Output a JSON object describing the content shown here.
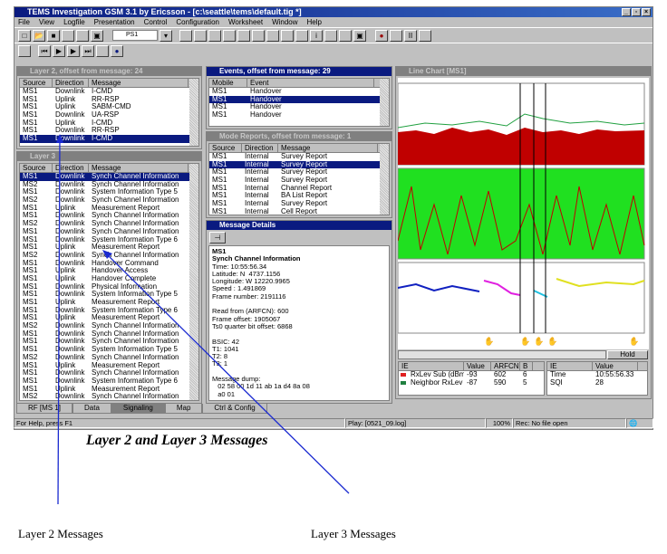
{
  "app": {
    "title": "TEMS Investigation GSM 3.1 by Ericsson - [c:\\seattle\\tems\\default.tig *]",
    "menu": [
      "File",
      "View",
      "Logfile",
      "Presentation",
      "Control",
      "Configuration",
      "Worksheet",
      "Window",
      "Help"
    ],
    "mobile_select": "PS1"
  },
  "layer2": {
    "title": "Layer 2, offset from message: 24",
    "columns": [
      "Source",
      "Direction",
      "Message"
    ],
    "rows": [
      [
        "MS1",
        "Downlink",
        "I-CMD"
      ],
      [
        "MS1",
        "Uplink",
        "RR-RSP"
      ],
      [
        "MS1",
        "Uplink",
        "SABM-CMD"
      ],
      [
        "MS1",
        "Downlink",
        "UA-RSP"
      ],
      [
        "MS1",
        "Uplink",
        "I-CMD"
      ],
      [
        "MS1",
        "Downlink",
        "RR-RSP"
      ],
      [
        "MS1",
        "Downlink",
        "I-CMD"
      ]
    ],
    "selected": 6
  },
  "layer3": {
    "title": "Layer 3",
    "columns": [
      "Source",
      "Direction",
      "Message"
    ],
    "rows": [
      [
        "MS1",
        "Downlink",
        "Synch Channel Information"
      ],
      [
        "MS2",
        "Downlink",
        "Synch Channel Information"
      ],
      [
        "MS1",
        "Downlink",
        "System Information Type 5"
      ],
      [
        "MS2",
        "Downlink",
        "Synch Channel Information"
      ],
      [
        "MS1",
        "Uplink",
        "Measurement Report"
      ],
      [
        "MS1",
        "Downlink",
        "Synch Channel Information"
      ],
      [
        "MS2",
        "Downlink",
        "Synch Channel Information"
      ],
      [
        "MS1",
        "Downlink",
        "Synch Channel Information"
      ],
      [
        "MS1",
        "Downlink",
        "System Information Type 6"
      ],
      [
        "MS1",
        "Uplink",
        "Measurement Report"
      ],
      [
        "MS2",
        "Downlink",
        "Synch Channel Information"
      ],
      [
        "MS1",
        "Downlink",
        "Handover Command"
      ],
      [
        "MS1",
        "Uplink",
        "Handover Access"
      ],
      [
        "MS1",
        "Uplink",
        "Handover Complete"
      ],
      [
        "MS1",
        "Downlink",
        "Physical Information"
      ],
      [
        "MS1",
        "Downlink",
        "System Information Type 5"
      ],
      [
        "MS1",
        "Uplink",
        "Measurement Report"
      ],
      [
        "MS1",
        "Downlink",
        "System Information Type 6"
      ],
      [
        "MS1",
        "Uplink",
        "Measurement Report"
      ],
      [
        "MS2",
        "Downlink",
        "Synch Channel Information"
      ],
      [
        "MS1",
        "Downlink",
        "Synch Channel Information"
      ],
      [
        "MS1",
        "Downlink",
        "Synch Channel Information"
      ],
      [
        "MS1",
        "Downlink",
        "System Information Type 5"
      ],
      [
        "MS2",
        "Downlink",
        "Synch Channel Information"
      ],
      [
        "MS1",
        "Uplink",
        "Measurement Report"
      ],
      [
        "MS1",
        "Downlink",
        "Synch Channel Information"
      ],
      [
        "MS1",
        "Downlink",
        "System Information Type 6"
      ],
      [
        "MS1",
        "Uplink",
        "Measurement Report"
      ],
      [
        "MS2",
        "Downlink",
        "Synch Channel Information"
      ]
    ],
    "selected": 0
  },
  "events": {
    "title": "Events, offset from message: 29",
    "columns": [
      "Mobile",
      "Event"
    ],
    "rows": [
      [
        "MS1",
        "Handover"
      ],
      [
        "MS1",
        "Handover"
      ],
      [
        "MS1",
        "Handover"
      ],
      [
        "MS1",
        "Handover"
      ]
    ],
    "selected": 1
  },
  "mode_reports": {
    "title": "Mode Reports, offset from message: 1",
    "columns": [
      "Source",
      "Direction",
      "Message"
    ],
    "rows": [
      [
        "MS1",
        "Internal",
        "Survey Report"
      ],
      [
        "MS1",
        "Internal",
        "Survey Report"
      ],
      [
        "MS1",
        "Internal",
        "Survey Report"
      ],
      [
        "MS1",
        "Internal",
        "Survey Report"
      ],
      [
        "MS1",
        "Internal",
        "Channel Report"
      ],
      [
        "MS1",
        "Internal",
        "BA List Report"
      ],
      [
        "MS1",
        "Internal",
        "Survey Report"
      ],
      [
        "MS1",
        "Internal",
        "Cell Report"
      ]
    ],
    "selected": 1
  },
  "details": {
    "title": "Message Details",
    "bold": [
      "MS1",
      "Synch Channel Information"
    ],
    "lines": [
      "Time: 10:55:56.34",
      "Latitude: N  4737.1156",
      "Longitude: W 12220.9965",
      "Speed : 1.491869",
      "Frame number: 2191116",
      "",
      "Read from (ARFCN): 600",
      "Frame offset: 1905067",
      "Ts0 quarter bit offset: 6868",
      "",
      "BSIC: 42",
      "T1: 1041",
      "T2: 8",
      "T3: 1",
      "",
      "Message dump:",
      "   02 58 00 1d 11 ab 1a d4 8a 08",
      "   a0 01"
    ]
  },
  "chart": {
    "title": "Line Chart [MS1]",
    "hold_label": "Hold",
    "ie_table": {
      "columns": [
        "IE",
        "Value",
        "ARFCN",
        "B"
      ],
      "rows": [
        {
          "ie": "RxLev Sub (dBm)",
          "value": "-93",
          "arfcn": "602",
          "b": "6",
          "color": "#e02020"
        },
        {
          "ie": "Neighbor RxLev (d...",
          "value": "-87",
          "arfcn": "590",
          "b": "5",
          "color": "#208040"
        }
      ]
    },
    "ie_table2": {
      "columns": [
        "IE",
        "Value"
      ],
      "rows": [
        [
          "Time",
          "10:55:56.33"
        ],
        [
          "SQI",
          "28"
        ]
      ]
    }
  },
  "tabs": [
    "RF [MS 1]",
    "Data",
    "Signaling",
    "Map",
    "Ctrl & Config"
  ],
  "active_tab": "Signaling",
  "status": {
    "help": "For Help, press F1",
    "play": "Play: [0521_09.log]",
    "zoom": "100%",
    "rec": "Rec: No file open"
  },
  "caption": "Layer 2 and Layer 3 Messages",
  "labels": {
    "layer2": "Layer 2 Messages",
    "layer3": "Layer 3 Messages"
  }
}
